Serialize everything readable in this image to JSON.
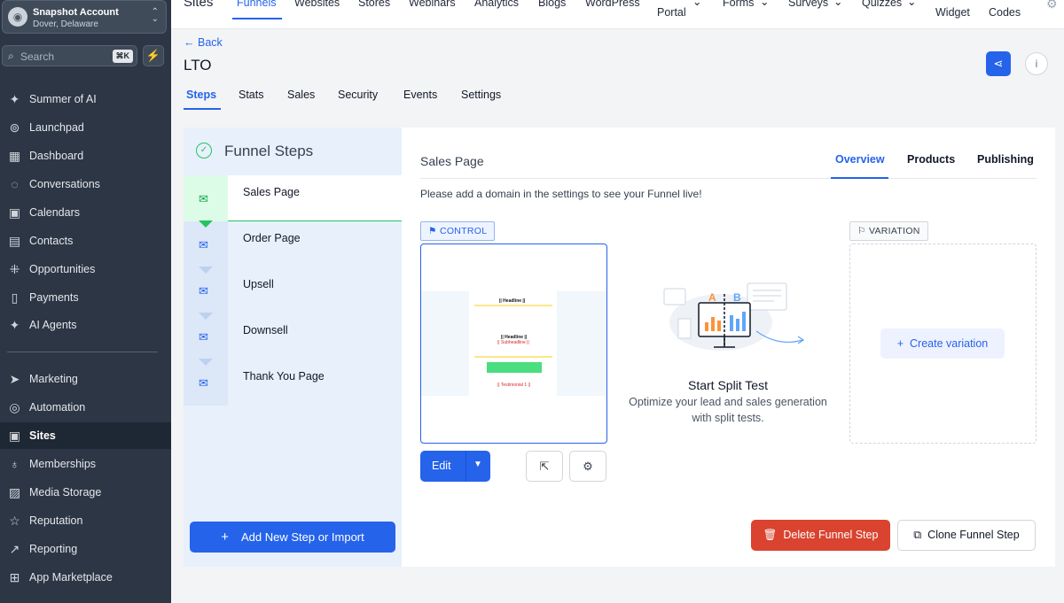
{
  "account": {
    "name": "Snapshot Account",
    "location": "Dover, Delaware"
  },
  "search": {
    "placeholder": "Search",
    "shortcut": "⌘K"
  },
  "sidebar": {
    "items": [
      {
        "label": "Summer of AI",
        "icon": "sparkle-icon"
      },
      {
        "label": "Launchpad",
        "icon": "rocket-icon"
      },
      {
        "label": "Dashboard",
        "icon": "grid-icon"
      },
      {
        "label": "Conversations",
        "icon": "chat-icon"
      },
      {
        "label": "Calendars",
        "icon": "calendar-icon"
      },
      {
        "label": "Contacts",
        "icon": "contacts-icon"
      },
      {
        "label": "Opportunities",
        "icon": "opportunities-icon"
      },
      {
        "label": "Payments",
        "icon": "payments-icon"
      },
      {
        "label": "AI Agents",
        "icon": "sparkle-icon"
      },
      {
        "label": "Marketing",
        "icon": "send-icon"
      },
      {
        "label": "Automation",
        "icon": "automation-icon"
      },
      {
        "label": "Sites",
        "icon": "sites-icon"
      },
      {
        "label": "Memberships",
        "icon": "membership-icon"
      },
      {
        "label": "Media Storage",
        "icon": "image-icon"
      },
      {
        "label": "Reputation",
        "icon": "star-icon"
      },
      {
        "label": "Reporting",
        "icon": "chart-icon"
      },
      {
        "label": "App Marketplace",
        "icon": "apps-icon"
      }
    ],
    "active": "Sites"
  },
  "topnav": {
    "items": [
      "Sites",
      "Funnels",
      "Websites",
      "Stores",
      "Webinars",
      "Analytics",
      "Blogs",
      "WordPress",
      "Portal",
      "Forms",
      "Surveys",
      "Quizzes",
      "Widget",
      "Codes"
    ],
    "active": "Funnels"
  },
  "page": {
    "back": "Back",
    "title": "LTO"
  },
  "tabs": [
    "Steps",
    "Stats",
    "Sales",
    "Security",
    "Events",
    "Settings"
  ],
  "funnel_steps": {
    "heading": "Funnel Steps",
    "steps": [
      "Sales Page",
      "Order Page",
      "Upsell",
      "Downsell",
      "Thank You Page"
    ],
    "add_button": "Add New Step or Import"
  },
  "step_detail": {
    "title": "Sales Page",
    "tabs": [
      "Overview",
      "Products",
      "Publishing"
    ],
    "message": "Please add a domain in the settings to see your Funnel live!",
    "control_label": "CONTROL",
    "variation_label": "VARIATION",
    "edit_label": "Edit",
    "split_title": "Start Split Test",
    "split_desc": "Optimize your lead and sales generation with split tests.",
    "create_variation": "Create variation",
    "delete_button": "Delete Funnel Step",
    "clone_button": "Clone Funnel Step"
  },
  "preview": {
    "headline": "|| Headline ||",
    "subheadline": "|| Subheadline ||",
    "testimonial": "|| Testimonial 1 ||"
  },
  "colors": {
    "primary": "#2563eb",
    "danger": "#d9432f",
    "success": "#22c55e",
    "sidebar": "#2c3645"
  }
}
